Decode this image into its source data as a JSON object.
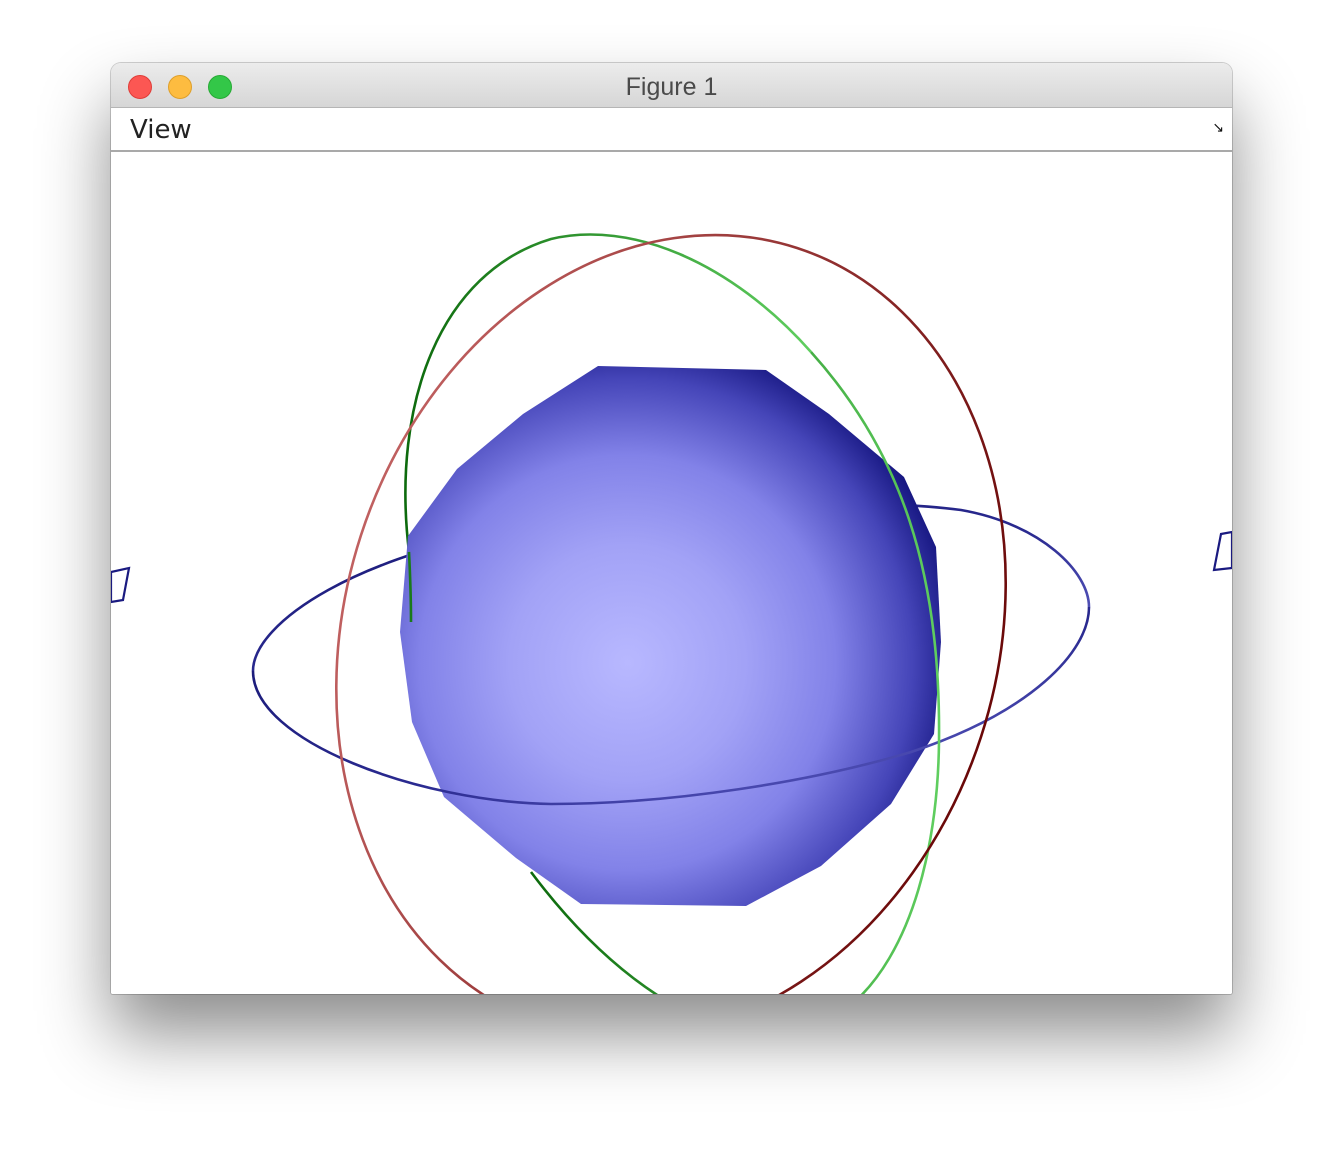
{
  "window": {
    "title": "Figure 1"
  },
  "titlebar": {
    "buttons": [
      "close-button",
      "minimize-button",
      "zoom-button"
    ]
  },
  "menubar": {
    "items": [
      {
        "label": "View"
      }
    ],
    "resize_glyph": "↘"
  },
  "scene": {
    "sphere_color": "#8c8cf0",
    "sphere_dark": "#12127a",
    "orbit_colors": {
      "equatorial": "#1a1a80",
      "green": "#1a8a1a",
      "red": "#7a1010"
    }
  }
}
